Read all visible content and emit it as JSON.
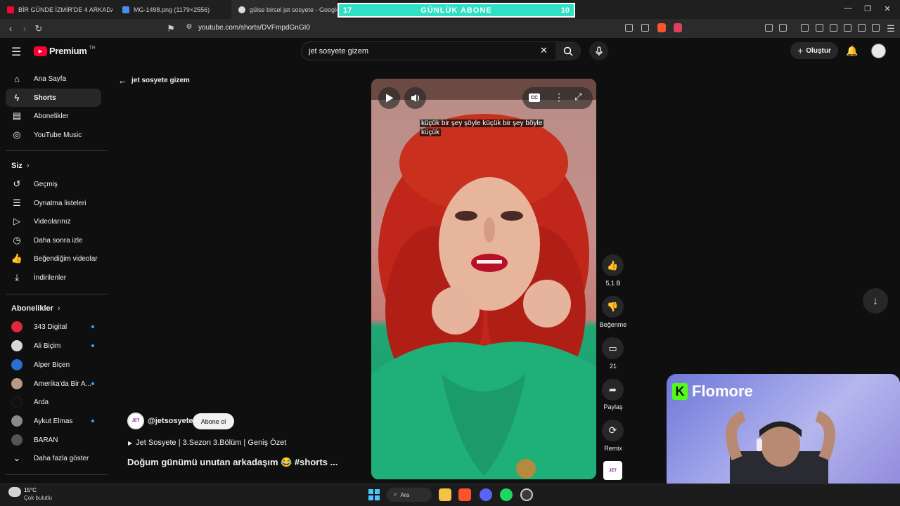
{
  "browser": {
    "tabs": [
      {
        "label": "BİR GÜNDE İZMİR'DE 4 ARKADAŞ NE...",
        "color": "#ff0033"
      },
      {
        "label": "MG-1498.png (1179×2556)",
        "color": "#4a8df0"
      },
      {
        "label": "gülse birsel jet sosyete - Google'da...",
        "color": "#dddddd"
      }
    ],
    "url": "youtube.com/shorts/DVFmpdGnGI0",
    "window_controls": {
      "minimize": "—",
      "restore": "❐",
      "close": "✕"
    }
  },
  "overlay_banner": {
    "left": "17",
    "title": "GÜNLÜK ABONE",
    "right": "10",
    "color": "#2fe0c4"
  },
  "youtube": {
    "logo": "Premium",
    "region": "TR",
    "search_value": "jet sosyete gizem",
    "create_label": "Oluştur",
    "back_label": "jet sosyete gizem"
  },
  "sidebar": {
    "main": [
      {
        "label": "Ana Sayfa",
        "icon": "home-icon",
        "glyph": "⌂"
      },
      {
        "label": "Shorts",
        "icon": "shorts-icon",
        "glyph": "ϟ"
      },
      {
        "label": "Abonelikler",
        "icon": "subscriptions-icon",
        "glyph": "▤"
      },
      {
        "label": "YouTube Music",
        "icon": "music-icon",
        "glyph": "◎"
      }
    ],
    "you_header": "Siz",
    "you": [
      {
        "label": "Geçmiş",
        "icon": "history-icon",
        "glyph": "↺"
      },
      {
        "label": "Oynatma listeleri",
        "icon": "playlists-icon",
        "glyph": "☰"
      },
      {
        "label": "Videolarınız",
        "icon": "your-videos-icon",
        "glyph": "▷"
      },
      {
        "label": "Daha sonra izle",
        "icon": "watch-later-icon",
        "glyph": "◷"
      },
      {
        "label": "Beğendiğim videolar",
        "icon": "liked-icon",
        "glyph": "👍"
      },
      {
        "label": "İndirilenler",
        "icon": "downloads-icon",
        "glyph": "⤓"
      }
    ],
    "subs_header": "Abonelikler",
    "subs": [
      {
        "label": "343 Digital",
        "color": "#e0283a",
        "dot": true
      },
      {
        "label": "Ali Biçim",
        "color": "#d8d8d8",
        "dot": true
      },
      {
        "label": "Alper Biçen",
        "color": "#2a6fd6",
        "dot": false
      },
      {
        "label": "Amerika'da Bir A...",
        "color": "#b89a86",
        "dot": true
      },
      {
        "label": "Arda",
        "color": "#111111",
        "dot": false
      },
      {
        "label": "Aykut Elmas",
        "color": "#8a8a8a",
        "dot": true
      },
      {
        "label": "BARAN",
        "color": "#555555",
        "dot": false
      }
    ],
    "show_more": "Daha fazla göster"
  },
  "short": {
    "caption_line1": "küçük bir şey şöyle küçük bir şey böyle",
    "caption_line2": "küçük",
    "channel": "@jetsosyete",
    "subscribe_label": "Abone ol",
    "playlist": "Jet Sosyete | 3.Sezon 3.Bölüm | Geniş Özet",
    "title": "Doğum günümü unutan arkadaşım 😂 #shorts ...",
    "cc_label": "CC",
    "actions": [
      {
        "label": "5,1 B",
        "icon": "like-icon",
        "glyph": "👍"
      },
      {
        "label": "Beğenme",
        "icon": "dislike-icon",
        "glyph": "👎"
      },
      {
        "label": "21",
        "icon": "comment-icon",
        "glyph": "▭"
      },
      {
        "label": "Paylaş",
        "icon": "share-icon",
        "glyph": "➦"
      },
      {
        "label": "Remix",
        "icon": "remix-icon",
        "glyph": "⟳"
      }
    ]
  },
  "webcam": {
    "brand": "Flomore",
    "brand_letter": "K",
    "brand_color": "#53fc18"
  },
  "taskbar": {
    "weather_temp": "15°C",
    "weather_desc": "Çok bulutlu",
    "search_label": "Ara"
  }
}
